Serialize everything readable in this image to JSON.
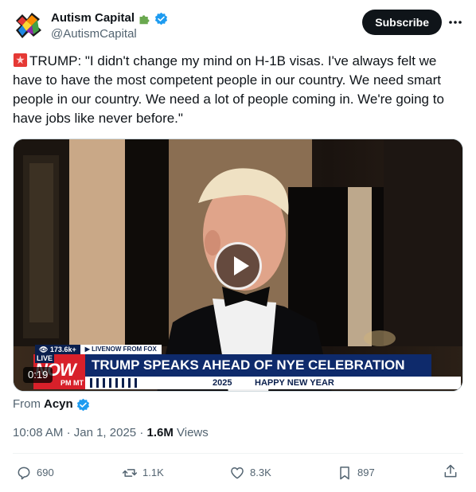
{
  "author": {
    "name": "Autism Capital",
    "name_emoji": "puzzle-piece",
    "handle": "@AutismCapital",
    "verified": true
  },
  "subscribe_label": "Subscribe",
  "tweet": {
    "emoji": "police-siren",
    "text": "TRUMP: \"I didn't change my mind on H-1B visas. I've always felt we have to have the most competent people in our country. We need smart people in our country. We need a lot of people coming in. We're going to have jobs like never before.\""
  },
  "video": {
    "duration": "0:19",
    "chyron": {
      "views": "👁 173.6k+",
      "source": "▶ LIVENOW FROM FOX",
      "headline": "TRUMP SPEAKS AHEAD OF NYE CELEBRATION",
      "year": "2025",
      "subline": "HAPPY NEW YEAR",
      "logo_live": "LIVE",
      "logo_now": "NOW",
      "logo_time": "PM MT"
    }
  },
  "from": {
    "prefix": "From",
    "name": "Acyn"
  },
  "meta": {
    "time": "10:08 AM",
    "date": "Jan 1, 2025",
    "views": "1.6M",
    "views_label": "Views"
  },
  "actions": {
    "replies": "690",
    "reposts": "1.1K",
    "likes": "8.3K",
    "bookmarks": "897"
  },
  "colors": {
    "verified": "#1d9bf0",
    "text_secondary": "#536471",
    "button_dark": "#0f1419"
  }
}
